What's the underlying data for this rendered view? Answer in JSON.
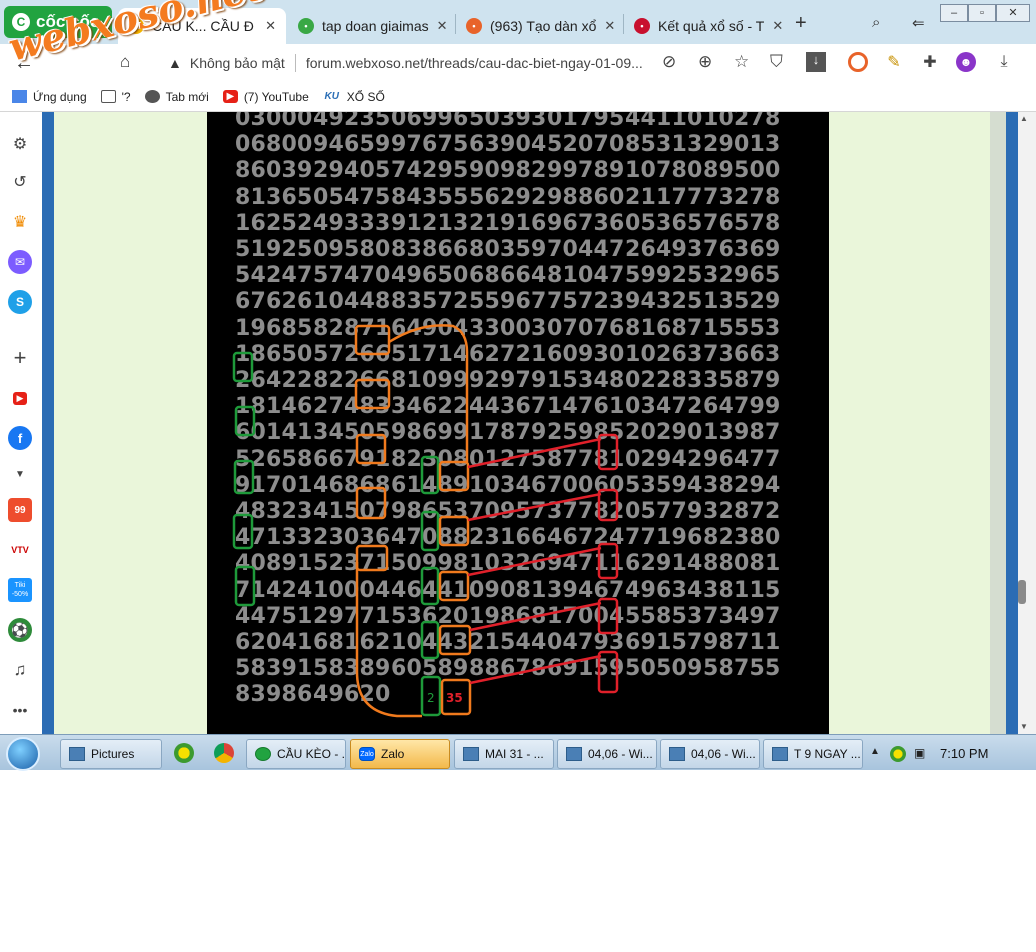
{
  "browser": {
    "brand": "cốc cốc",
    "tabs": [
      {
        "label": "CẦU K... CẦU Đ",
        "favicon": "xs-icon",
        "active": true
      },
      {
        "label": "tap doan giaimas",
        "favicon": "leaf-icon",
        "active": false
      },
      {
        "label": "(963) Tạo dàn xổ",
        "favicon": "fire-icon",
        "active": false
      },
      {
        "label": "Kết quả xổ số - T",
        "favicon": "globe-icon",
        "active": false
      }
    ],
    "new_tab_symbol": "+",
    "address": {
      "security_label": "Không bảo mật",
      "url": "forum.webxoso.net/threads/cau-dac-biet-ngay-01-09..."
    },
    "bookmarks": [
      {
        "label": "Ứng dụng",
        "icon": "apps-icon"
      },
      {
        "label": "'?",
        "icon": "folder-icon"
      },
      {
        "label": "Tab mới",
        "icon": "globe-icon"
      },
      {
        "label": "(7) YouTube",
        "icon": "youtube-icon"
      },
      {
        "label": "XỔ SỐ",
        "icon": "ku-icon",
        "icon_text": "KU"
      }
    ]
  },
  "watermark": "webxoso.net",
  "sidebar_icons": [
    "settings-icon",
    "history-icon",
    "crown-icon",
    "messenger-icon",
    "skype-icon",
    "add-icon",
    "youtube-icon",
    "facebook-icon",
    "more-down-icon",
    "shopee-icon",
    "vtv-icon",
    "tiki-icon",
    "football-icon",
    "bell-icon",
    "more-icon"
  ],
  "sidebar_texts": {
    "shopee": "99",
    "vtv": "VTV",
    "tiki": "Tiki -50%"
  },
  "number_grid": {
    "rows": [
      [
        "03000",
        "49235",
        "06996",
        "50393",
        "01795",
        "44110",
        "10278"
      ],
      [
        "06800",
        "94659",
        "97675",
        "63904",
        "52070",
        "85313",
        "29013"
      ],
      [
        "86039",
        "29405",
        "74295",
        "90982",
        "99789",
        "10780",
        "89500"
      ],
      [
        "81365",
        "05475",
        "84355",
        "56292",
        "98860",
        "21177",
        "73278"
      ],
      [
        "16252",
        "49333",
        "91213",
        "21916",
        "96736",
        "05365",
        "76578"
      ],
      [
        "51925",
        "09580",
        "83866",
        "80359",
        "70447",
        "26493",
        "76369"
      ],
      [
        "54247",
        "57470",
        "49650",
        "68664",
        "81047",
        "59925",
        "32965"
      ],
      [
        "67626",
        "10448",
        "83572",
        "55967",
        "75723",
        "94325",
        "13529"
      ],
      [
        "19685",
        "82871",
        "64904",
        "33003",
        "07076",
        "81687",
        "15553"
      ],
      [
        "18650",
        "57266",
        "51714",
        "62721",
        "60930",
        "10263",
        "73663"
      ],
      [
        "26422",
        "82266",
        "81099",
        "92979",
        "15348",
        "02283",
        "35879"
      ],
      [
        "18146",
        "27483",
        "34622",
        "44367",
        "14761",
        "03472",
        "64799"
      ],
      [
        "60141",
        "34505",
        "98699",
        "17879",
        "25985",
        "20290",
        "13987"
      ],
      [
        "52658",
        "66791",
        "82308",
        "01275",
        "87781",
        "02942",
        "96477"
      ],
      [
        "91701",
        "46868",
        "61489",
        "10346",
        "70060",
        "53594",
        "38294"
      ],
      [
        "48323",
        "41507",
        "98653",
        "70957",
        "37782",
        "05779",
        "32872"
      ],
      [
        "47133",
        "23036",
        "47088",
        "23166",
        "46724",
        "77196",
        "82380"
      ],
      [
        "40891",
        "52371",
        "50998",
        "10326",
        "94711",
        "62914",
        "88081"
      ],
      [
        "71424",
        "10004",
        "46441",
        "09081",
        "39467",
        "49634",
        "38115"
      ],
      [
        "44751",
        "29771",
        "53620",
        "19868",
        "17004",
        "55853",
        "73497"
      ],
      [
        "62041",
        "68162",
        "10443",
        "21544",
        "04793",
        "69157",
        "98711"
      ],
      [
        "58391",
        "58389",
        "60589",
        "88678",
        "69159",
        "50509",
        "58755"
      ],
      [
        "83986",
        "49620"
      ]
    ],
    "annotation_labels": {
      "green_bottom": "2",
      "red_bottom": "35"
    },
    "colors": {
      "digits": "#8d8d8d",
      "green": "#1e9a3a",
      "orange": "#f07a1d",
      "red": "#e0202a"
    }
  },
  "taskbar": {
    "items": [
      {
        "label": "Pictures",
        "active": false
      },
      {
        "label": "CẦU KÈO - ...",
        "active": false
      },
      {
        "label": "Zalo",
        "active": true
      },
      {
        "label": "MAI 31 - ...",
        "active": false
      },
      {
        "label": "04,06 - Wi...",
        "active": false
      },
      {
        "label": "04,06 - Wi...",
        "active": false
      },
      {
        "label": "T 9 NGAY ...",
        "active": false
      }
    ],
    "clock": "7:10 PM"
  }
}
